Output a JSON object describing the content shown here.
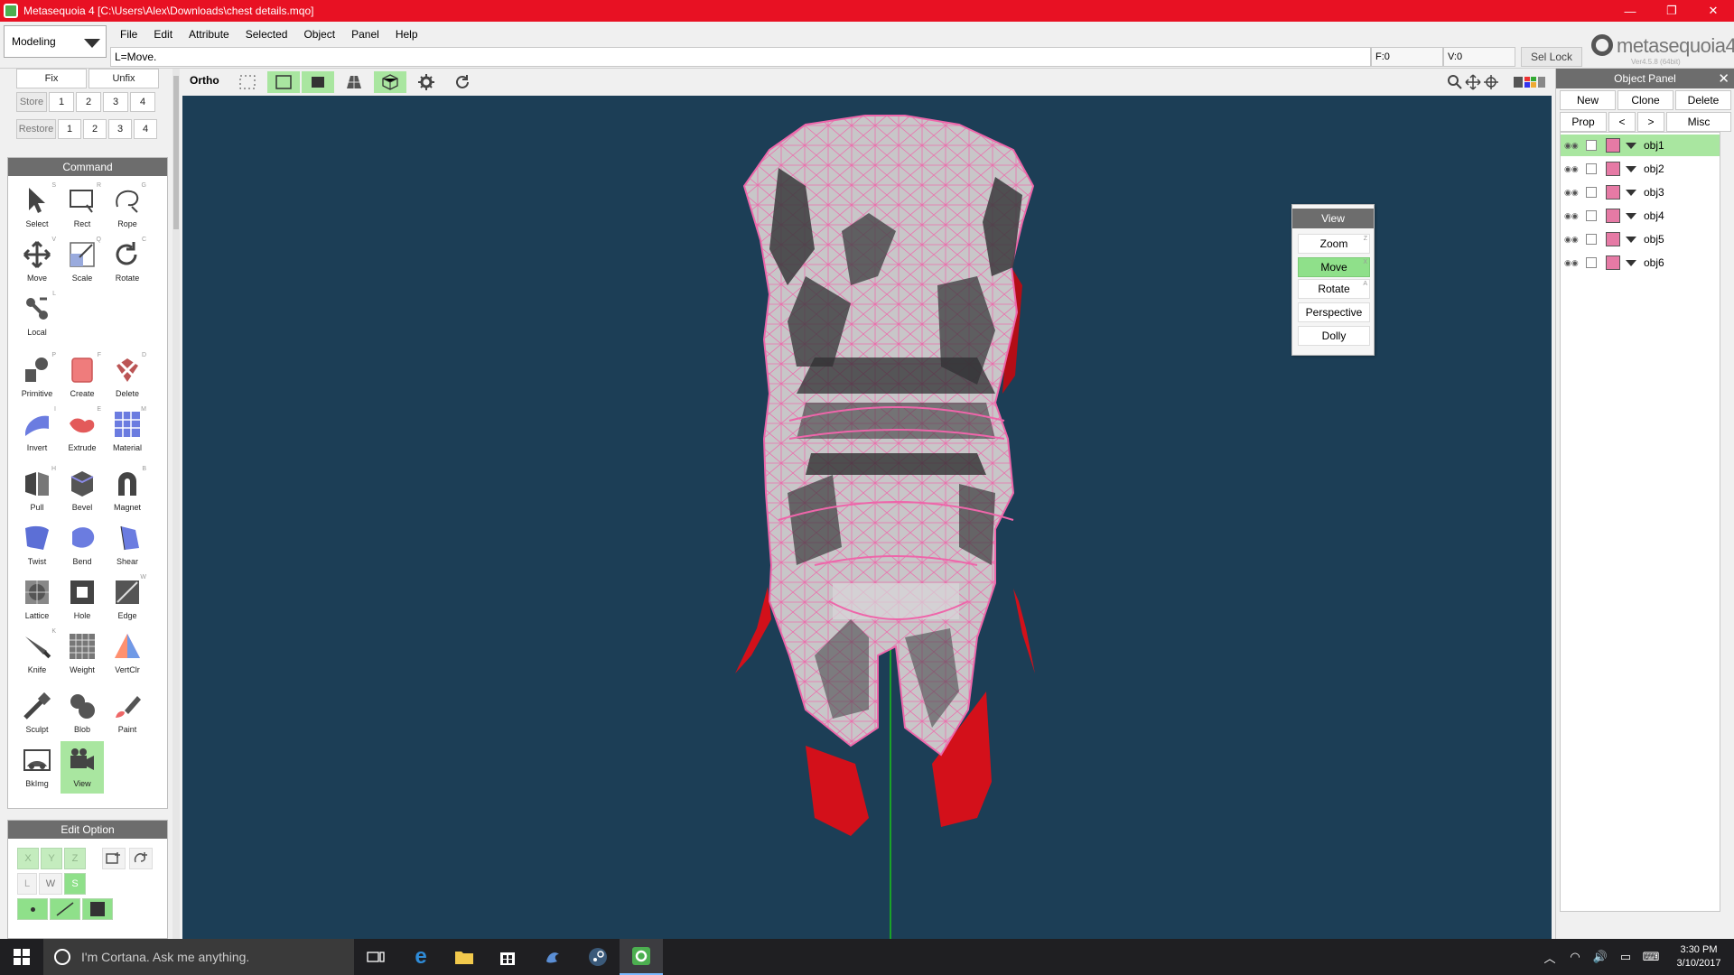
{
  "window": {
    "title": "Metasequoia 4 [C:\\Users\\Alex\\Downloads\\chest details.mqo]",
    "controls": [
      "—",
      "❐",
      "✕"
    ]
  },
  "menubar": {
    "mode": "Modeling",
    "menus": [
      "File",
      "Edit",
      "Attribute",
      "Selected",
      "Object",
      "Panel",
      "Help"
    ],
    "status": "L=Move.",
    "face_count": "F:0",
    "vertex_count": "V:0",
    "sel_lock": "Sel Lock",
    "brand": "metasequoia4",
    "version": "Ver4.5.8 (64bit)"
  },
  "left_top": {
    "fix": "Fix",
    "unfix": "Unfix",
    "store": "Store",
    "restore": "Restore",
    "slots": [
      "1",
      "2",
      "3",
      "4"
    ]
  },
  "command_panel": {
    "title": "Command",
    "tools": [
      {
        "label": "Select",
        "key": "S",
        "icon": "select-arrow-icon"
      },
      {
        "label": "Rect",
        "key": "R",
        "icon": "rect-select-icon"
      },
      {
        "label": "Rope",
        "key": "G",
        "icon": "rope-select-icon"
      },
      {
        "label": "Move",
        "key": "V",
        "icon": "move-arrows-icon"
      },
      {
        "label": "Scale",
        "key": "Q",
        "icon": "scale-icon"
      },
      {
        "label": "Rotate",
        "key": "C",
        "icon": "rotate-icon"
      },
      {
        "label": "Local",
        "key": "L",
        "icon": "local-icon"
      },
      {
        "label": "Primitive",
        "key": "P",
        "icon": "primitive-icon"
      },
      {
        "label": "Create",
        "key": "F",
        "icon": "create-face-icon"
      },
      {
        "label": "Delete",
        "key": "D",
        "icon": "delete-icon"
      },
      {
        "label": "Invert",
        "key": "I",
        "icon": "invert-icon"
      },
      {
        "label": "Extrude",
        "key": "E",
        "icon": "extrude-icon"
      },
      {
        "label": "Material",
        "key": "M",
        "icon": "material-icon"
      },
      {
        "label": "Pull",
        "key": "H",
        "icon": "pull-icon"
      },
      {
        "label": "Bevel",
        "key": "",
        "icon": "bevel-icon"
      },
      {
        "label": "Magnet",
        "key": "B",
        "icon": "magnet-icon"
      },
      {
        "label": "Twist",
        "key": "",
        "icon": "twist-icon"
      },
      {
        "label": "Bend",
        "key": "",
        "icon": "bend-icon"
      },
      {
        "label": "Shear",
        "key": "",
        "icon": "shear-icon"
      },
      {
        "label": "Lattice",
        "key": "",
        "icon": "lattice-icon"
      },
      {
        "label": "Hole",
        "key": "",
        "icon": "hole-icon"
      },
      {
        "label": "Edge",
        "key": "W",
        "icon": "edge-icon"
      },
      {
        "label": "Knife",
        "key": "K",
        "icon": "knife-icon"
      },
      {
        "label": "Weight",
        "key": "",
        "icon": "weight-icon"
      },
      {
        "label": "VertClr",
        "key": "",
        "icon": "vertex-color-icon"
      },
      {
        "label": "Sculpt",
        "key": "",
        "icon": "sculpt-icon"
      },
      {
        "label": "Blob",
        "key": "",
        "icon": "blob-icon"
      },
      {
        "label": "Paint",
        "key": "",
        "icon": "paint-icon"
      },
      {
        "label": "BkImg",
        "key": "",
        "icon": "background-image-icon"
      },
      {
        "label": "View",
        "key": "",
        "icon": "view-camera-icon",
        "active": true
      }
    ]
  },
  "edit_option": {
    "title": "Edit Option",
    "axes": [
      "X",
      "Y",
      "Z"
    ],
    "coords": [
      "L",
      "W",
      "S"
    ]
  },
  "viewport_toolbar": {
    "ortho": "Ortho"
  },
  "view_popup": {
    "title": "View",
    "items": [
      {
        "label": "Zoom",
        "key": "Z"
      },
      {
        "label": "Move",
        "key": "X",
        "active": true
      },
      {
        "label": "Rotate",
        "key": "A"
      },
      {
        "label": "Perspective",
        "key": ""
      },
      {
        "label": "Dolly",
        "key": ""
      }
    ]
  },
  "object_panel": {
    "title": "Object Panel",
    "buttons_row1": [
      "New",
      "Clone",
      "Delete"
    ],
    "buttons_row2": [
      "Prop",
      "<",
      ">",
      "Misc"
    ],
    "objects": [
      {
        "name": "obj1",
        "selected": true
      },
      {
        "name": "obj2"
      },
      {
        "name": "obj3"
      },
      {
        "name": "obj4"
      },
      {
        "name": "obj5"
      },
      {
        "name": "obj6"
      }
    ]
  },
  "taskbar": {
    "search_placeholder": "I'm Cortana. Ask me anything.",
    "time": "3:30 PM",
    "date": "3/10/2017"
  },
  "colors": {
    "titlebar": "#e81123",
    "viewport_bg": "#1c3e56",
    "active_green": "#a9e6a0",
    "wireframe": "#ee66aa",
    "mesh_red": "#d3101a"
  }
}
